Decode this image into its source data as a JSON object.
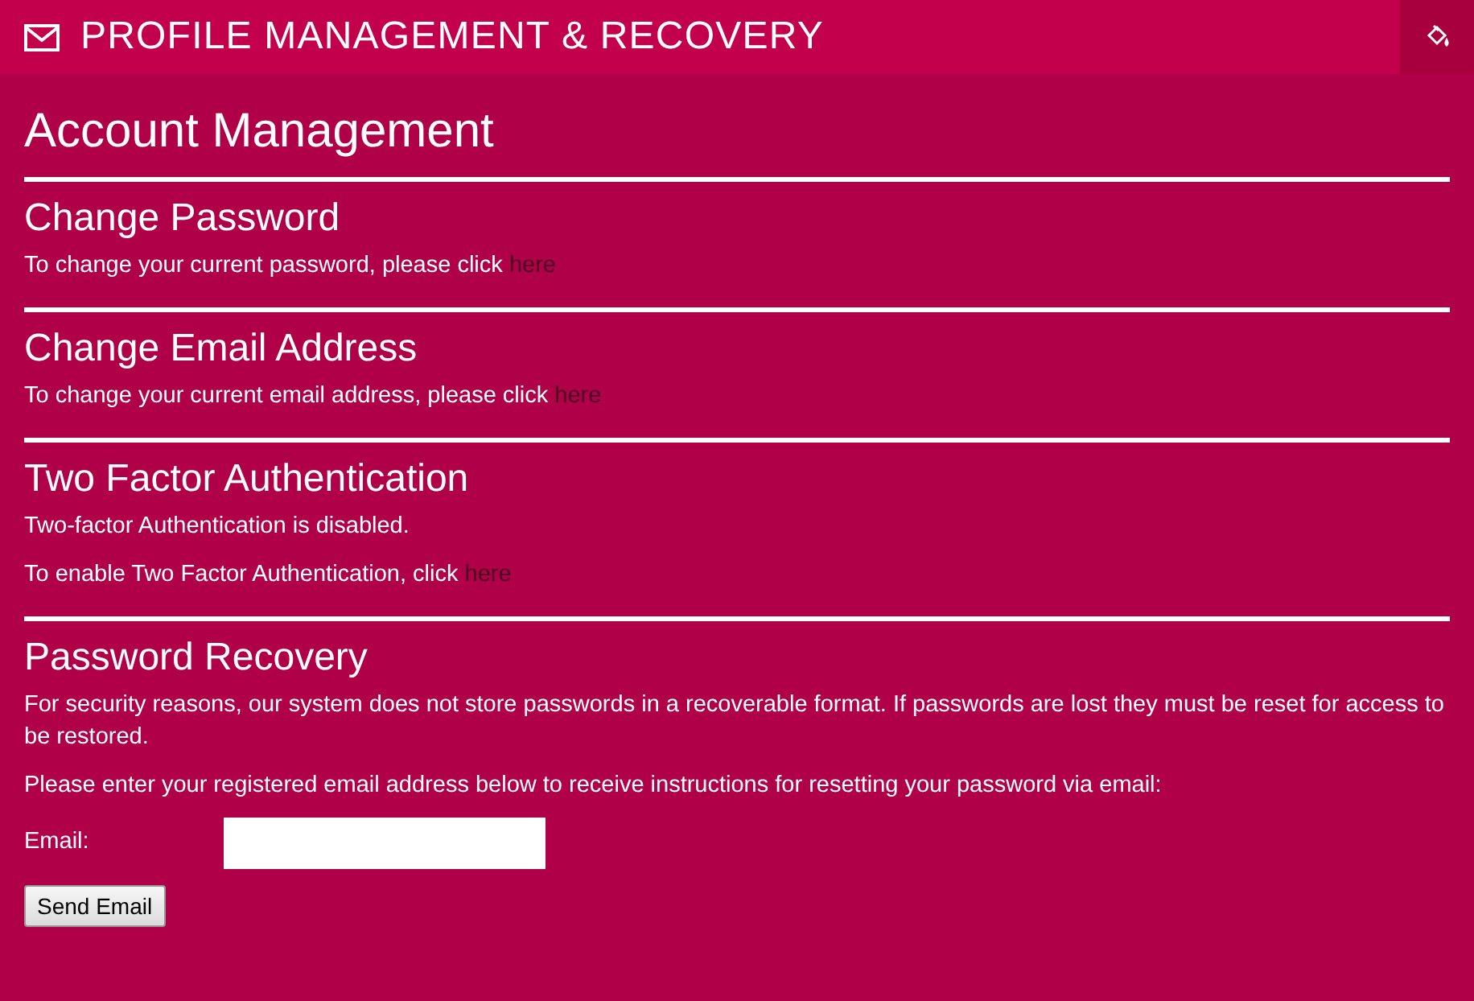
{
  "header": {
    "title": "PROFILE MANAGEMENT & RECOVERY"
  },
  "page_title": "Account Management",
  "sections": [
    {
      "title": "Change Password",
      "paragraphs": [
        {
          "text": "To change your current password, please click",
          "link": "here"
        }
      ]
    },
    {
      "title": "Change Email Address",
      "paragraphs": [
        {
          "text": "To change your current email address, please click",
          "link": "here"
        }
      ]
    },
    {
      "title": "Two Factor Authentication",
      "paragraphs": [
        {
          "text": "Two-factor Authentication is disabled."
        },
        {
          "text": "To enable Two Factor Authentication, click",
          "link": "here"
        }
      ]
    },
    {
      "title": "Password Recovery",
      "paragraphs": [
        {
          "text": "For security reasons, our system does not store passwords in a recoverable format. If passwords are lost they must be reset for access to be restored."
        },
        {
          "text": "Please enter your registered email address below to receive instructions for resetting your password via email:"
        }
      ],
      "form": {
        "label": "Email:",
        "button": "Send Email"
      }
    }
  ]
}
